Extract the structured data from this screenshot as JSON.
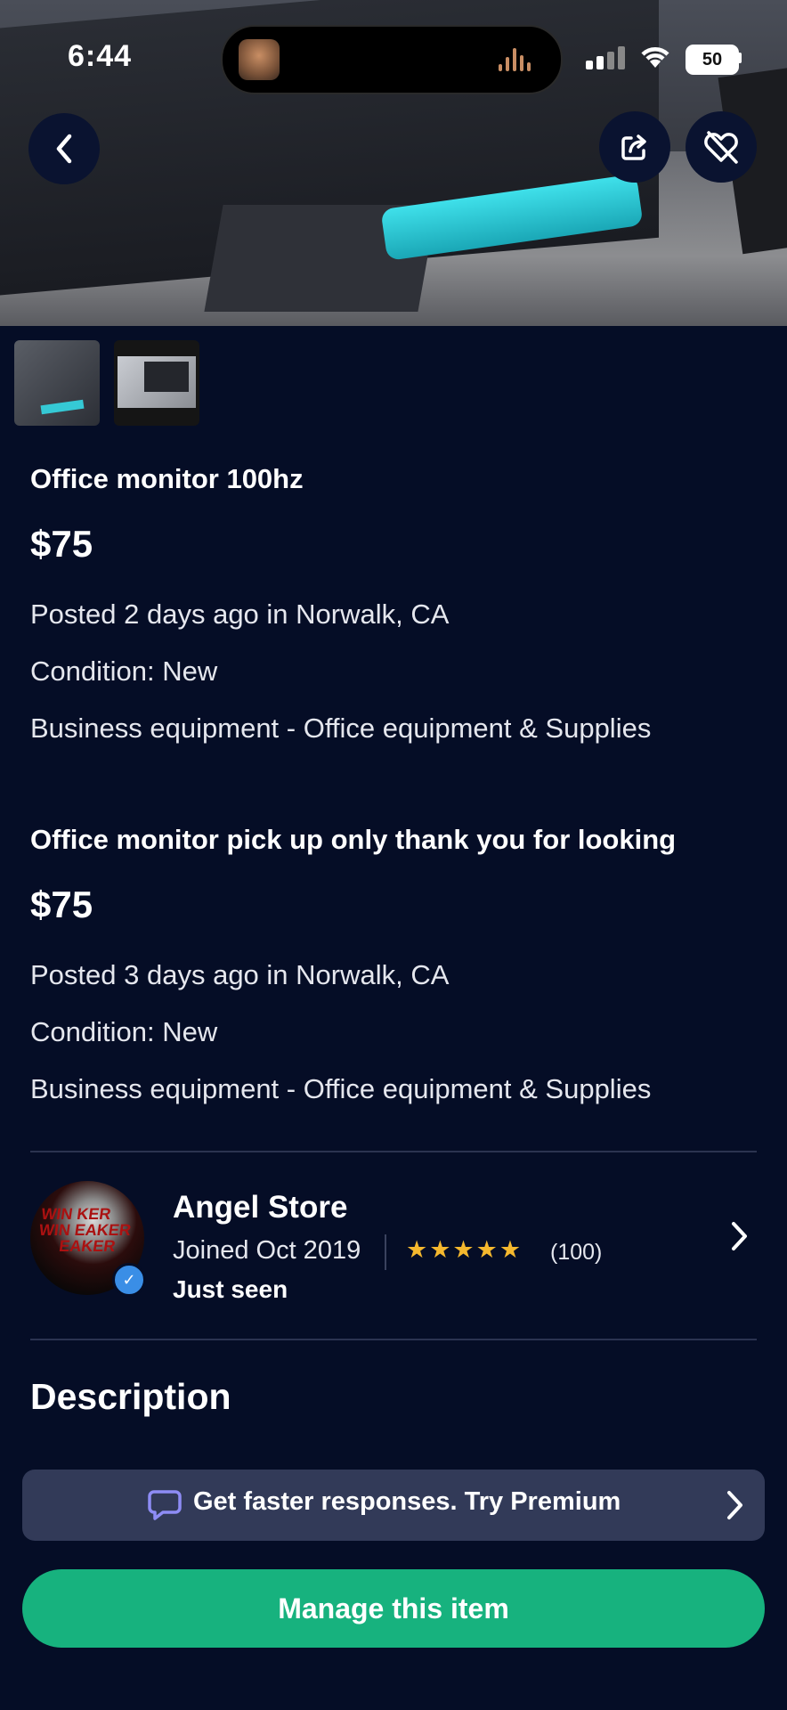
{
  "status_bar": {
    "time": "6:44",
    "battery": "50"
  },
  "listing_1": {
    "title": "Office monitor 100hz",
    "price": "$75",
    "posted": "Posted 2 days ago in Norwalk, CA",
    "condition": "Condition: New",
    "category": "Business equipment - Office equipment & Supplies"
  },
  "listing_2": {
    "title": "Office monitor pick up only thank you for looking",
    "price": "$75",
    "posted": "Posted 3 days ago in Norwalk, CA",
    "condition": "Condition: New",
    "category": "Business equipment - Office equipment & Supplies"
  },
  "seller": {
    "name": "Angel Store",
    "joined": "Joined Oct 2019",
    "stars": "★★★★★",
    "rating_count": "(100)",
    "last_seen": "Just seen",
    "rating": 5
  },
  "description_heading": "Description",
  "premium_banner": {
    "text": "Get faster responses.  Try Premium"
  },
  "manage_button": "Manage this item",
  "icons": {
    "back": "chevron-left-icon",
    "share": "share-icon",
    "unsave": "heart-off-icon",
    "premium": "chat-bubble-icon",
    "chevron": "chevron-right-icon",
    "verified": "verified-badge-icon"
  },
  "colors": {
    "background": "#050d26",
    "accent_green": "#17b27e",
    "banner": "#323a58",
    "star": "#f5b82e",
    "verified": "#3a8ee6"
  }
}
